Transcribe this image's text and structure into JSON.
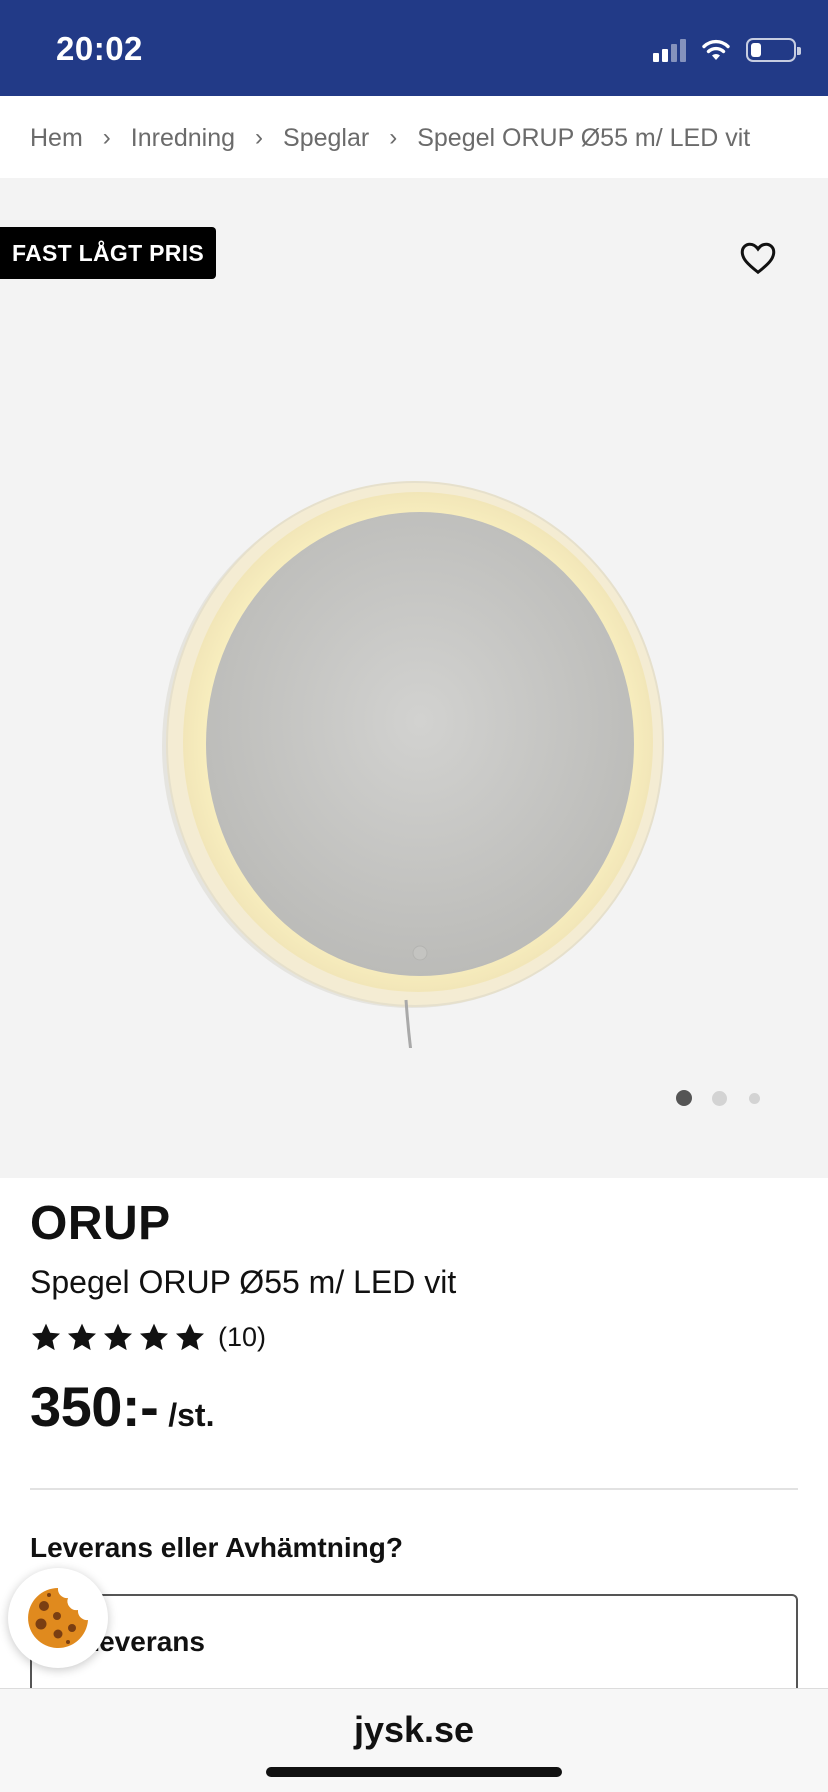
{
  "status_bar": {
    "time": "20:02",
    "background": "#223a87",
    "battery_level": 0.25,
    "signal_bars": 2,
    "icons": [
      "signal-icon",
      "wifi-icon",
      "battery-icon"
    ]
  },
  "breadcrumb": {
    "items": [
      "Hem",
      "Inredning",
      "Speglar",
      "Spegel ORUP Ø55 m/ LED vit"
    ],
    "separator": "›"
  },
  "gallery": {
    "badge": "FAST LÅGT PRIS",
    "favorite_icon": "heart-icon",
    "image_count": 3,
    "active_index": 0
  },
  "product": {
    "brand": "ORUP",
    "name": "Spegel ORUP Ø55 m/ LED vit",
    "rating_stars": 5,
    "rating_count": "(10)",
    "price": "350:-",
    "price_unit": "/st."
  },
  "delivery": {
    "heading": "Leverans eller Avhämtning?",
    "option_label": "Leverans"
  },
  "cookie": {
    "icon": "cookie-icon"
  },
  "browser": {
    "url": "jysk.se"
  }
}
